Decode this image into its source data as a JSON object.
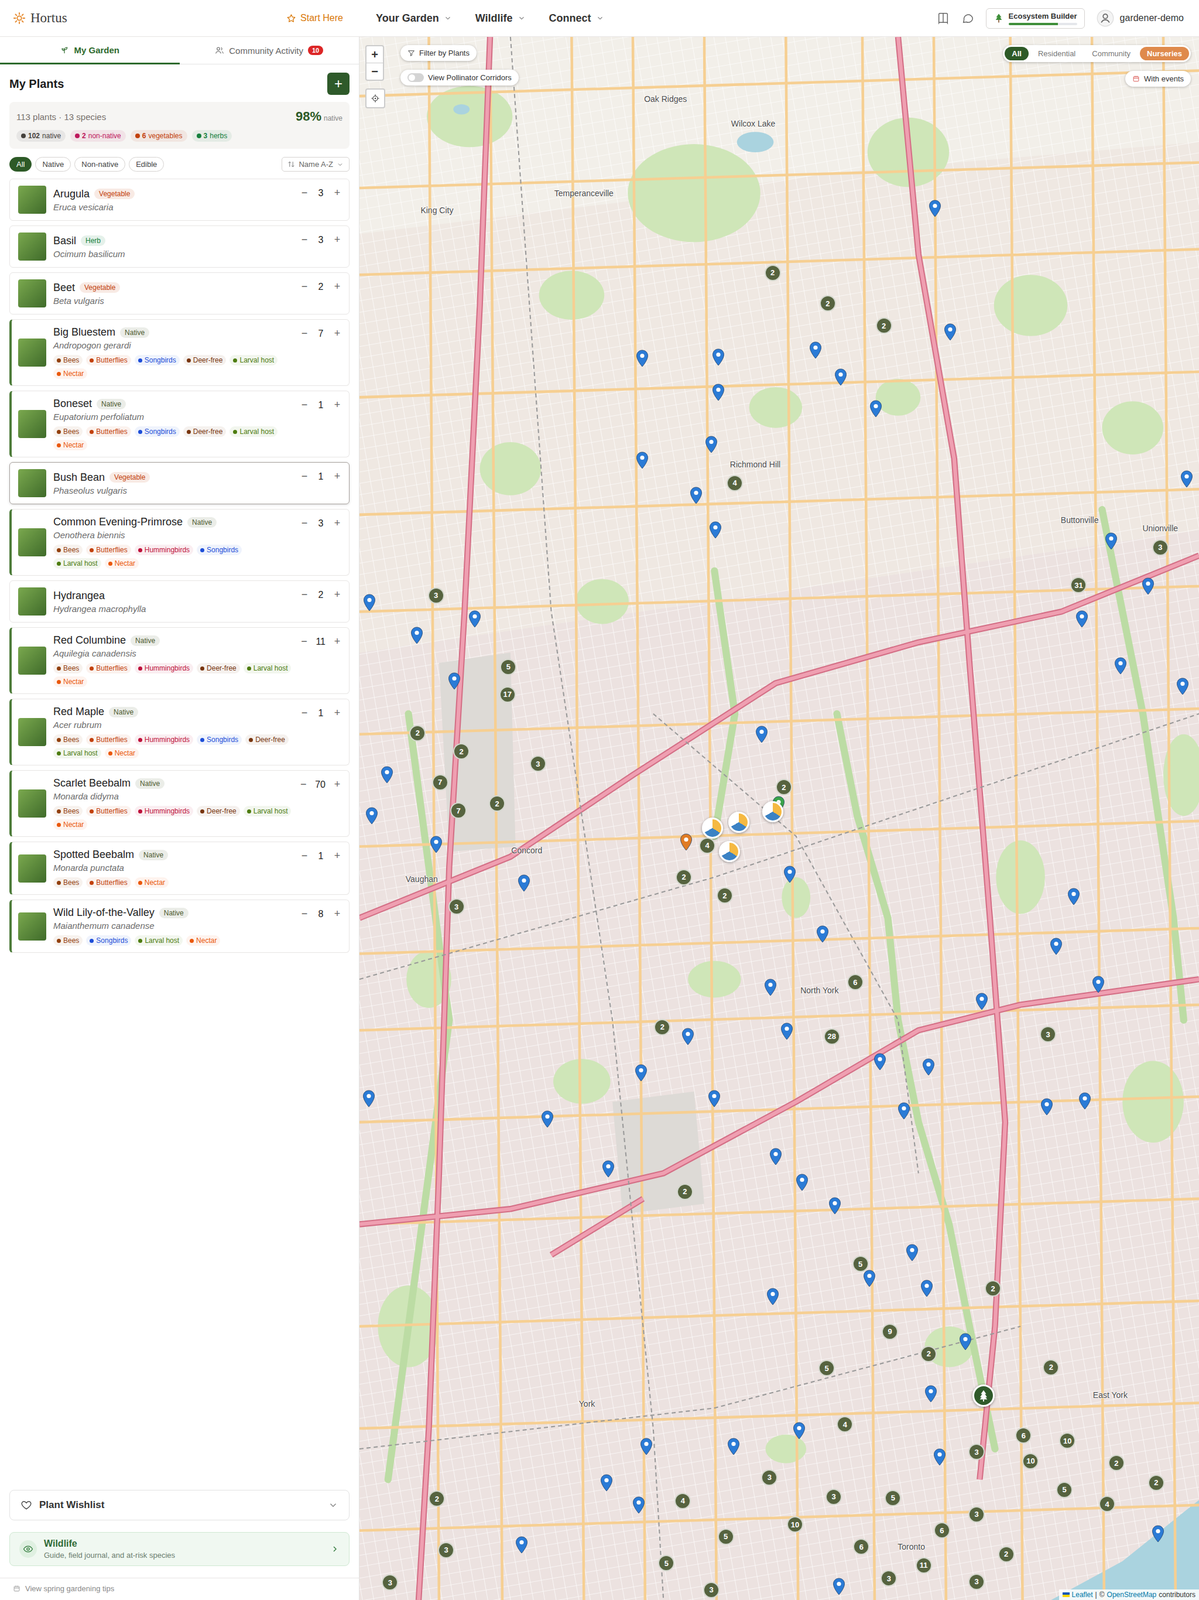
{
  "header": {
    "logo": "Hortus",
    "start_here": "Start Here",
    "nav": [
      {
        "label": "Your Garden"
      },
      {
        "label": "Wildlife"
      },
      {
        "label": "Connect"
      }
    ],
    "ecosystem_builder": {
      "label": "Ecosystem Builder",
      "level": 0.72
    },
    "user": "gardener-demo"
  },
  "tabs": [
    {
      "label": "My Garden",
      "selected": true
    },
    {
      "label": "Community Activity",
      "selected": false,
      "badge": "10"
    }
  ],
  "garden": {
    "title": "My Plants",
    "add": "+",
    "summary": "113 plants · 13 species",
    "native_percent": "98%",
    "native_label": "native",
    "counts": [
      {
        "count": "102",
        "label": "native",
        "color": "#44403c"
      },
      {
        "count": "2",
        "label": "non-native",
        "color": "#be185d"
      },
      {
        "count": "6",
        "label": "vegetables",
        "color": "#c2410c"
      },
      {
        "count": "3",
        "label": "herbs",
        "color": "#15803d"
      }
    ],
    "filters": [
      {
        "label": "All",
        "selected": true
      },
      {
        "label": "Native",
        "selected": false
      },
      {
        "label": "Non-native",
        "selected": false
      },
      {
        "label": "Edible",
        "selected": false
      }
    ],
    "sort": "Name A-Z",
    "counter": {
      "minus": "−",
      "plus": "+"
    },
    "plants": [
      {
        "name": "Arugula",
        "scientific": "Eruca vesicaria",
        "badge": {
          "label": "Vegetable",
          "color": "#c2410c"
        },
        "native": false,
        "highlighted": false,
        "count": "3",
        "tags": []
      },
      {
        "name": "Basil",
        "scientific": "Ocimum basilicum",
        "badge": {
          "label": "Herb",
          "color": "#15803d"
        },
        "native": false,
        "highlighted": false,
        "count": "3",
        "tags": []
      },
      {
        "name": "Beet",
        "scientific": "Beta vulgaris",
        "badge": {
          "label": "Vegetable",
          "color": "#c2410c"
        },
        "native": false,
        "highlighted": false,
        "count": "2",
        "tags": []
      },
      {
        "name": "Big Bluestem",
        "scientific": "Andropogon gerardi",
        "badge": {
          "label": "Native",
          "color": "#4d5a2e"
        },
        "native": true,
        "highlighted": false,
        "count": "7",
        "tags": [
          {
            "label": "Bees",
            "color": "#92400e"
          },
          {
            "label": "Butterflies",
            "color": "#c2410c"
          },
          {
            "label": "Songbirds",
            "color": "#1d4ed8"
          },
          {
            "label": "Deer-free",
            "color": "#78350f"
          },
          {
            "label": "Larval host",
            "color": "#4d7c0f"
          },
          {
            "label": "Nectar",
            "color": "#ea580c"
          }
        ]
      },
      {
        "name": "Boneset",
        "scientific": "Eupatorium perfoliatum",
        "badge": {
          "label": "Native",
          "color": "#4d5a2e"
        },
        "native": true,
        "highlighted": false,
        "count": "1",
        "tags": [
          {
            "label": "Bees",
            "color": "#92400e"
          },
          {
            "label": "Butterflies",
            "color": "#c2410c"
          },
          {
            "label": "Songbirds",
            "color": "#1d4ed8"
          },
          {
            "label": "Deer-free",
            "color": "#78350f"
          },
          {
            "label": "Larval host",
            "color": "#4d7c0f"
          },
          {
            "label": "Nectar",
            "color": "#ea580c"
          }
        ]
      },
      {
        "name": "Bush Bean",
        "scientific": "Phaseolus vulgaris",
        "badge": {
          "label": "Vegetable",
          "color": "#c2410c"
        },
        "native": false,
        "highlighted": true,
        "count": "1",
        "tags": []
      },
      {
        "name": "Common Evening-Primrose",
        "scientific": "Oenothera biennis",
        "badge": {
          "label": "Native",
          "color": "#4d5a2e"
        },
        "native": true,
        "highlighted": false,
        "count": "3",
        "tags": [
          {
            "label": "Bees",
            "color": "#92400e"
          },
          {
            "label": "Butterflies",
            "color": "#c2410c"
          },
          {
            "label": "Hummingbirds",
            "color": "#be123c"
          },
          {
            "label": "Songbirds",
            "color": "#1d4ed8"
          },
          {
            "label": "Larval host",
            "color": "#4d7c0f"
          },
          {
            "label": "Nectar",
            "color": "#ea580c"
          }
        ]
      },
      {
        "name": "Hydrangea",
        "scientific": "Hydrangea macrophylla",
        "native": false,
        "highlighted": false,
        "count": "2",
        "tags": []
      },
      {
        "name": "Red Columbine",
        "scientific": "Aquilegia canadensis",
        "badge": {
          "label": "Native",
          "color": "#4d5a2e"
        },
        "native": true,
        "highlighted": false,
        "count": "11",
        "tags": [
          {
            "label": "Bees",
            "color": "#92400e"
          },
          {
            "label": "Butterflies",
            "color": "#c2410c"
          },
          {
            "label": "Hummingbirds",
            "color": "#be123c"
          },
          {
            "label": "Deer-free",
            "color": "#78350f"
          },
          {
            "label": "Larval host",
            "color": "#4d7c0f"
          },
          {
            "label": "Nectar",
            "color": "#ea580c"
          }
        ]
      },
      {
        "name": "Red Maple",
        "scientific": "Acer rubrum",
        "badge": {
          "label": "Native",
          "color": "#4d5a2e"
        },
        "native": true,
        "highlighted": false,
        "count": "1",
        "tags": [
          {
            "label": "Bees",
            "color": "#92400e"
          },
          {
            "label": "Butterflies",
            "color": "#c2410c"
          },
          {
            "label": "Hummingbirds",
            "color": "#be123c"
          },
          {
            "label": "Songbirds",
            "color": "#1d4ed8"
          },
          {
            "label": "Deer-free",
            "color": "#78350f"
          },
          {
            "label": "Larval host",
            "color": "#4d7c0f"
          },
          {
            "label": "Nectar",
            "color": "#ea580c"
          }
        ]
      },
      {
        "name": "Scarlet Beebalm",
        "scientific": "Monarda didyma",
        "badge": {
          "label": "Native",
          "color": "#4d5a2e"
        },
        "native": true,
        "highlighted": false,
        "count": "70",
        "tags": [
          {
            "label": "Bees",
            "color": "#92400e"
          },
          {
            "label": "Butterflies",
            "color": "#c2410c"
          },
          {
            "label": "Hummingbirds",
            "color": "#be123c"
          },
          {
            "label": "Deer-free",
            "color": "#78350f"
          },
          {
            "label": "Larval host",
            "color": "#4d7c0f"
          },
          {
            "label": "Nectar",
            "color": "#ea580c"
          }
        ]
      },
      {
        "name": "Spotted Beebalm",
        "scientific": "Monarda punctata",
        "badge": {
          "label": "Native",
          "color": "#4d5a2e"
        },
        "native": true,
        "highlighted": false,
        "count": "1",
        "tags": [
          {
            "label": "Bees",
            "color": "#92400e"
          },
          {
            "label": "Butterflies",
            "color": "#c2410c"
          },
          {
            "label": "Nectar",
            "color": "#ea580c"
          }
        ]
      },
      {
        "name": "Wild Lily-of-the-Valley",
        "scientific": "Maianthemum canadense",
        "badge": {
          "label": "Native",
          "color": "#4d5a2e"
        },
        "native": true,
        "highlighted": false,
        "count": "8",
        "tags": [
          {
            "label": "Bees",
            "color": "#92400e"
          },
          {
            "label": "Songbirds",
            "color": "#1d4ed8"
          },
          {
            "label": "Larval host",
            "color": "#4d7c0f"
          },
          {
            "label": "Nectar",
            "color": "#ea580c"
          }
        ]
      }
    ]
  },
  "wishlist": {
    "title": "Plant Wishlist",
    "expanded": false
  },
  "wildlife": {
    "title": "Wildlife",
    "subtitle": "Guide, field journal, and at-risk species"
  },
  "footer": "View spring gardening tips",
  "map": {
    "zoom_in": "+",
    "zoom_out": "−",
    "filter": "Filter by Plants",
    "corridors": {
      "label": "View Pollinator Corridors",
      "on": false
    },
    "categories": [
      {
        "label": "All",
        "selected": true,
        "color": "#2d5a27"
      },
      {
        "label": "Residential",
        "selected": false,
        "color": "#2d5a27"
      },
      {
        "label": "Community",
        "selected": false,
        "color": "#2d5a27"
      },
      {
        "label": "Nurseries",
        "selected": true,
        "color": "#df8a4c"
      }
    ],
    "events": "With events",
    "attribution": {
      "leaflet": "Leaflet",
      "separator": "|",
      "copyright": "©",
      "osm": "OpenStreetMap",
      "contributors": "contributors"
    },
    "places": [
      "Oak Ridges",
      "Wilcox Lake",
      "Temperanceville",
      "King City",
      "Richmond Hill",
      "Buttonville",
      "Unionville",
      "Concord",
      "Vaughan",
      "North York",
      "York",
      "East York",
      "Toronto"
    ],
    "clusters": [
      {
        "count": "2"
      },
      {
        "count": "2"
      },
      {
        "count": "2"
      },
      {
        "count": "4"
      },
      {
        "count": "3"
      },
      {
        "count": "31"
      },
      {
        "count": "3"
      },
      {
        "count": "5"
      },
      {
        "count": "17"
      },
      {
        "count": "2"
      },
      {
        "count": "2"
      },
      {
        "count": "3"
      },
      {
        "count": "7"
      },
      {
        "count": "2"
      },
      {
        "count": "7"
      },
      {
        "count": "2"
      },
      {
        "count": "4"
      },
      {
        "count": "2"
      },
      {
        "count": "2"
      },
      {
        "count": "3"
      },
      {
        "count": "6"
      },
      {
        "count": "2"
      },
      {
        "count": "28"
      },
      {
        "count": "3"
      },
      {
        "count": "2"
      },
      {
        "count": "5"
      },
      {
        "count": "2"
      },
      {
        "count": "9"
      },
      {
        "count": "2"
      },
      {
        "count": "5"
      },
      {
        "count": "2"
      },
      {
        "count": "4"
      },
      {
        "count": "6"
      },
      {
        "count": "10"
      },
      {
        "count": "3"
      },
      {
        "count": "10"
      },
      {
        "count": "2"
      },
      {
        "count": "3"
      },
      {
        "count": "2"
      },
      {
        "count": "2"
      },
      {
        "count": "4"
      },
      {
        "count": "3"
      },
      {
        "count": "5"
      },
      {
        "count": "5"
      },
      {
        "count": "4"
      },
      {
        "count": "3"
      },
      {
        "count": "10"
      },
      {
        "count": "3"
      },
      {
        "count": "5"
      },
      {
        "count": "6"
      },
      {
        "count": "6"
      },
      {
        "count": "2"
      },
      {
        "count": "5"
      },
      {
        "count": "11"
      },
      {
        "count": "3"
      },
      {
        "count": "3"
      },
      {
        "count": "3"
      },
      {
        "count": "3"
      }
    ],
    "markers": [
      {
        "kind": "pin",
        "color": "#2b7bd6"
      },
      {
        "kind": "pin",
        "color": "#2b7bd6"
      },
      {
        "kind": "pin",
        "color": "#2b7bd6"
      },
      {
        "kind": "pin",
        "color": "#2b7bd6"
      },
      {
        "kind": "pin",
        "color": "#2b7bd6"
      },
      {
        "kind": "pin",
        "color": "#2b7bd6"
      },
      {
        "kind": "pin",
        "color": "#2b7bd6"
      },
      {
        "kind": "pin",
        "color": "#2b7bd6"
      },
      {
        "kind": "pin",
        "color": "#2b7bd6"
      },
      {
        "kind": "pin",
        "color": "#2b7bd6"
      },
      {
        "kind": "pin",
        "color": "#2b7bd6"
      },
      {
        "kind": "pin",
        "color": "#2b7bd6"
      },
      {
        "kind": "pin",
        "color": "#2b7bd6"
      },
      {
        "kind": "pin",
        "color": "#2b7bd6"
      },
      {
        "kind": "pin",
        "color": "#2b7bd6"
      },
      {
        "kind": "pin",
        "color": "#2b7bd6"
      },
      {
        "kind": "pin",
        "color": "#2b7bd6"
      },
      {
        "kind": "pin",
        "color": "#2b7bd6"
      },
      {
        "kind": "pin",
        "color": "#2b7bd6"
      },
      {
        "kind": "pin",
        "color": "#2b7bd6"
      },
      {
        "kind": "pin",
        "color": "#2b7bd6"
      },
      {
        "kind": "pin",
        "color": "#2b7bd6"
      },
      {
        "kind": "pin",
        "color": "#2b7bd6"
      },
      {
        "kind": "pin",
        "color": "#2b7bd6"
      },
      {
        "kind": "pin",
        "color": "#2b7bd6"
      },
      {
        "kind": "pin",
        "color": "#2b7bd6"
      },
      {
        "kind": "pin",
        "color": "#2b7bd6"
      },
      {
        "kind": "pin",
        "color": "#2b7bd6"
      },
      {
        "kind": "pin",
        "color": "#2b7bd6"
      },
      {
        "kind": "pin",
        "color": "#2b7bd6"
      },
      {
        "kind": "pin",
        "color": "#2b7bd6"
      },
      {
        "kind": "pin",
        "color": "#2b7bd6"
      },
      {
        "kind": "pin",
        "color": "#2b7bd6"
      },
      {
        "kind": "pin",
        "color": "#2b7bd6"
      },
      {
        "kind": "pin",
        "color": "#2b7bd6"
      },
      {
        "kind": "pin",
        "color": "#2b7bd6"
      },
      {
        "kind": "pin",
        "color": "#2b7bd6"
      },
      {
        "kind": "pin",
        "color": "#2b7bd6"
      },
      {
        "kind": "pin",
        "color": "#2b7bd6"
      },
      {
        "kind": "pin",
        "color": "#2b7bd6"
      },
      {
        "kind": "pin",
        "color": "#2b7bd6"
      },
      {
        "kind": "pin",
        "color": "#2b7bd6"
      },
      {
        "kind": "pin",
        "color": "#2b7bd6"
      },
      {
        "kind": "pin",
        "color": "#2b7bd6"
      },
      {
        "kind": "pin",
        "color": "#2b7bd6"
      },
      {
        "kind": "pin",
        "color": "#2b7bd6"
      },
      {
        "kind": "pin",
        "color": "#2b7bd6"
      },
      {
        "kind": "pin",
        "color": "#2b7bd6"
      },
      {
        "kind": "pin",
        "color": "#2b7bd6"
      },
      {
        "kind": "pin",
        "color": "#2b7bd6"
      },
      {
        "kind": "pin",
        "color": "#2b7bd6"
      },
      {
        "kind": "pin",
        "color": "#2b7bd6"
      },
      {
        "kind": "pin",
        "color": "#2b7bd6"
      },
      {
        "kind": "pin",
        "color": "#2b7bd6"
      },
      {
        "kind": "pin",
        "color": "#2b7bd6"
      },
      {
        "kind": "pin",
        "color": "#2b7bd6"
      },
      {
        "kind": "pin",
        "color": "#2b7bd6"
      },
      {
        "kind": "pin",
        "color": "#2b7bd6"
      },
      {
        "kind": "pin",
        "color": "#2b7bd6"
      },
      {
        "kind": "pin",
        "color": "#2b7bd6"
      },
      {
        "kind": "pin",
        "color": "#2b7bd6"
      },
      {
        "kind": "pin",
        "color": "#2b7bd6"
      },
      {
        "kind": "pin",
        "color": "#2b7bd6"
      },
      {
        "kind": "pin",
        "color": "#2b7bd6"
      },
      {
        "kind": "pin",
        "color": "#e07b24"
      },
      {
        "kind": "pin",
        "color": "#3aa34a"
      },
      {
        "kind": "garden",
        "color": "#f5b942"
      },
      {
        "kind": "garden",
        "color": "#f5b942"
      },
      {
        "kind": "garden",
        "color": "#f5b942"
      },
      {
        "kind": "garden",
        "color": "#f5b942"
      },
      {
        "kind": "tree",
        "color": "#2f5a2a"
      }
    ]
  }
}
